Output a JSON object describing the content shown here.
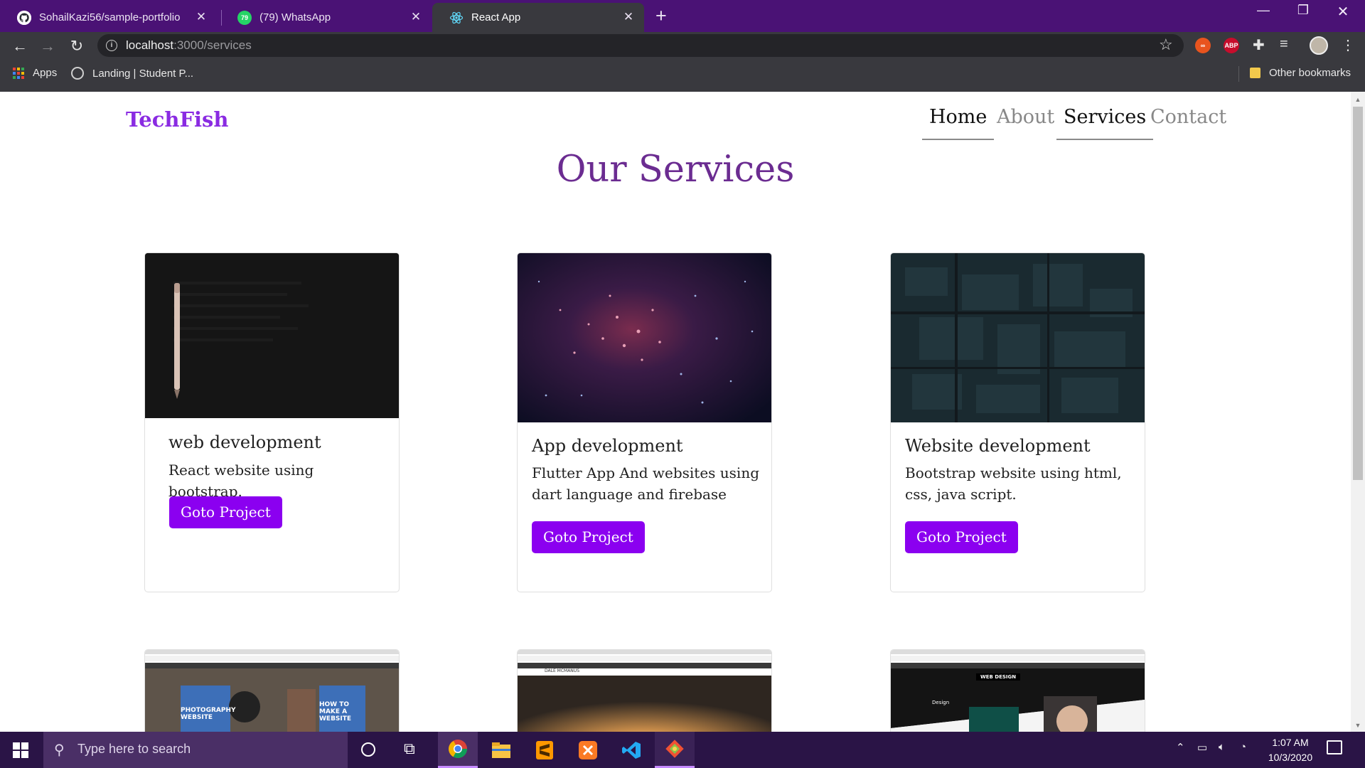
{
  "browser": {
    "tabs": [
      {
        "title": "SohailKazi56/sample-portfolio",
        "icon": "github-icon"
      },
      {
        "title": "(79) WhatsApp",
        "icon": "whatsapp-icon",
        "badge": "79"
      },
      {
        "title": "React App",
        "icon": "react-icon",
        "active": true
      }
    ],
    "url_host": "localhost",
    "url_rest": ":3000/services",
    "bookmarks": [
      {
        "label": "Apps",
        "icon": "apps-grid-icon"
      },
      {
        "label": "Landing | Student P...",
        "icon": "site-favicon-icon"
      }
    ],
    "other_bookmarks": "Other bookmarks",
    "extensions": {
      "abp": "ABP"
    }
  },
  "site": {
    "brand": "TechFish",
    "nav": [
      {
        "label": "Home",
        "active": true
      },
      {
        "label": "About",
        "active": false
      },
      {
        "label": "Services",
        "active": true
      },
      {
        "label": "Contact",
        "active": false
      }
    ],
    "page_title": "Our Services",
    "cards": [
      {
        "title": "web development",
        "text": "React website using bootstrap.",
        "button": "Goto Project",
        "image": "dark-pencil-photo"
      },
      {
        "title": "App development",
        "text": "Flutter App And websites using dart language and firebase",
        "button": "Goto Project",
        "image": "particle-galaxy-photo"
      },
      {
        "title": "Website development",
        "text": "Bootstrap website using html, css, java script.",
        "button": "Goto Project",
        "image": "aerial-city-night-photo"
      }
    ],
    "second_row": [
      {
        "image": "photography-website-screenshot",
        "labels": [
          "PHOTOGRAPHY WEBSITE",
          "HOW TO MAKE A WEBSITE"
        ]
      },
      {
        "image": "sunset-website-screenshot",
        "labels": [
          "DALE MCMANUS"
        ]
      },
      {
        "image": "web-design-screenshot",
        "labels": [
          "WEB DESIGN",
          "Design"
        ]
      }
    ]
  },
  "taskbar": {
    "search_placeholder": "Type here to search",
    "time": "1:07 AM",
    "date": "10/3/2020",
    "apps": [
      "chrome-icon",
      "file-explorer-icon",
      "sublime-text-icon",
      "xampp-icon",
      "vscode-icon",
      "git-icon"
    ]
  },
  "colors": {
    "tabstrip": "#4a1275",
    "toolbar": "#39393e",
    "brand": "#8a2be2",
    "title": "#6b2c91",
    "button": "#8b00f0",
    "taskbar": "#2a1446"
  }
}
